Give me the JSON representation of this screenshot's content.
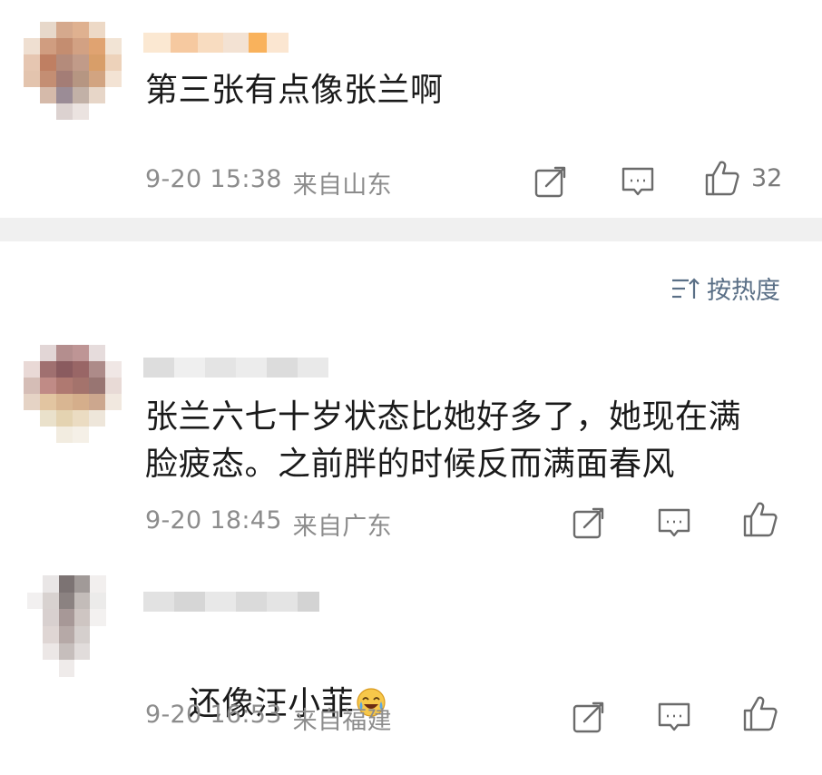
{
  "comments": [
    {
      "text": "第三张有点像张兰啊",
      "date": "9-20 15:38",
      "location": "来自山东",
      "likes": "32"
    },
    {
      "text": "张兰六七十岁状态比她好多了，她现在满\n脸疲态。之前胖的时候反而满面春风",
      "date": "9-20 18:45",
      "location": "来自广东",
      "likes": ""
    },
    {
      "text": "还像汪小菲",
      "emoji": "laugh-cry-emoji",
      "date": "9-20 16:53",
      "location": "来自福建",
      "likes": ""
    }
  ],
  "sort": {
    "label": "按热度",
    "icon": "sort-icon"
  },
  "icons": {
    "repost": "repost-icon",
    "comment": "comment-icon",
    "like": "like-icon"
  },
  "colors": {
    "text": "#1a1a1a",
    "meta": "#8c8c8c",
    "sort": "#5a6f86",
    "divider": "#f0f0f0",
    "icon": "#6b6b6b"
  }
}
